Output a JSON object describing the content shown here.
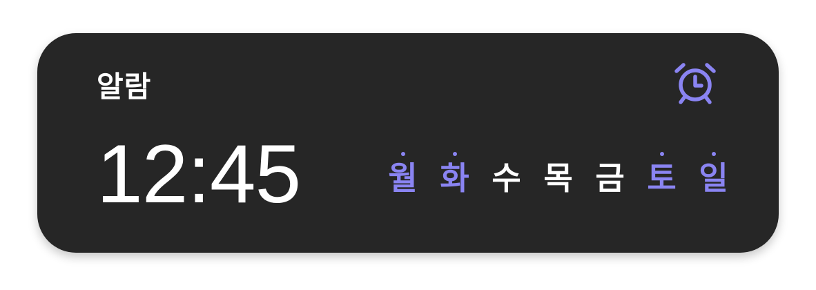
{
  "widget": {
    "title": "알람",
    "icon": "alarm-clock-icon",
    "accent_color": "#8a84f2",
    "background_color": "#262626",
    "time": "12:45",
    "days": [
      {
        "label": "월",
        "active": true
      },
      {
        "label": "화",
        "active": true
      },
      {
        "label": "수",
        "active": false
      },
      {
        "label": "목",
        "active": false
      },
      {
        "label": "금",
        "active": false
      },
      {
        "label": "토",
        "active": true
      },
      {
        "label": "일",
        "active": true
      }
    ]
  }
}
